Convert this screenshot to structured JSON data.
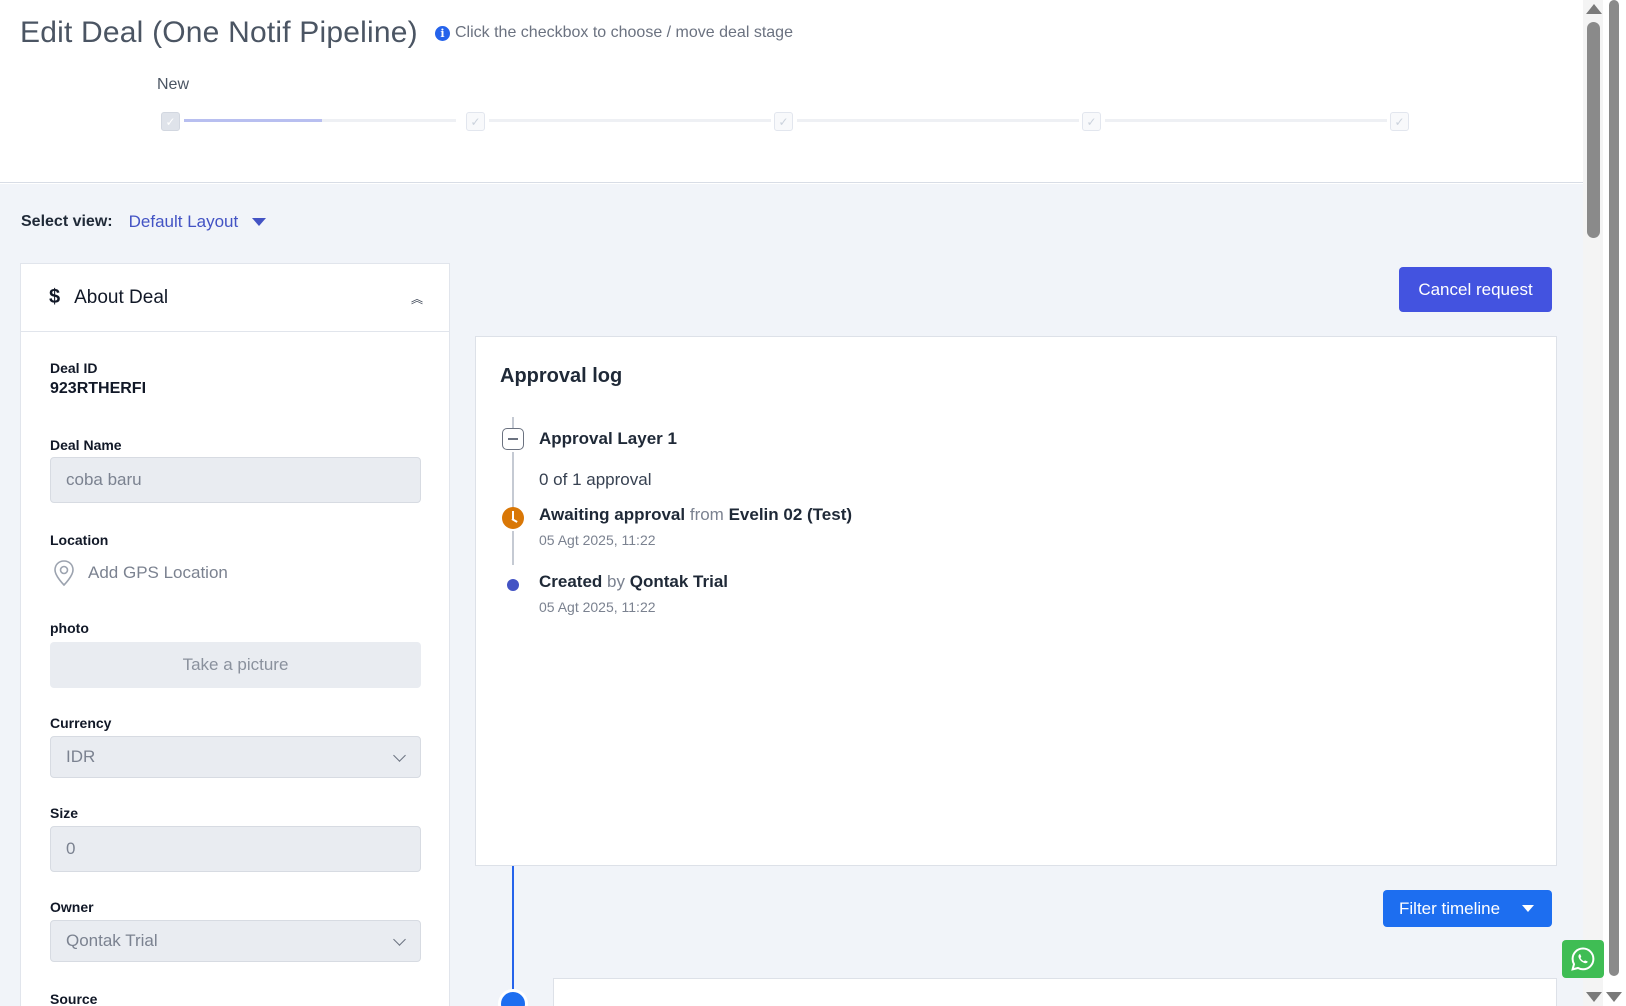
{
  "header": {
    "title": "Edit Deal (One Notif Pipeline)",
    "hint": "Click the checkbox to choose / move deal stage",
    "stages": [
      {
        "label": "New",
        "active": true
      },
      {
        "label": "",
        "active": false
      },
      {
        "label": "",
        "active": false
      },
      {
        "label": "",
        "active": false
      },
      {
        "label": "",
        "active": false
      }
    ]
  },
  "view": {
    "label": "Select view:",
    "value": "Default Layout"
  },
  "about": {
    "title": "About Deal",
    "fields": {
      "deal_id_label": "Deal ID",
      "deal_id_value": "923RTHERFI",
      "deal_name_label": "Deal Name",
      "deal_name_value": "coba baru",
      "location_label": "Location",
      "location_action": "Add GPS Location",
      "photo_label": "photo",
      "photo_action": "Take a picture",
      "currency_label": "Currency",
      "currency_value": "IDR",
      "size_label": "Size",
      "size_value": "0",
      "owner_label": "Owner",
      "owner_value": "Qontak Trial",
      "source_label": "Source"
    }
  },
  "actions": {
    "cancel_request": "Cancel request",
    "filter_timeline": "Filter timeline"
  },
  "approval": {
    "title": "Approval log",
    "layer_title": "Approval Layer 1",
    "layer_count": "0 of 1 approval",
    "entries": [
      {
        "status": "Awaiting approval",
        "connector": "from",
        "actor": "Evelin 02 (Test)",
        "time": "05 Agt 2025, 11:22"
      },
      {
        "status": "Created",
        "connector": "by",
        "actor": "Qontak Trial",
        "time": "05 Agt 2025, 11:22"
      }
    ]
  },
  "colors": {
    "primary": "#4353e0",
    "link": "#4353c4",
    "filter_button": "#1d6ef0",
    "awaiting": "#d97706",
    "whatsapp": "#3fbd54"
  }
}
